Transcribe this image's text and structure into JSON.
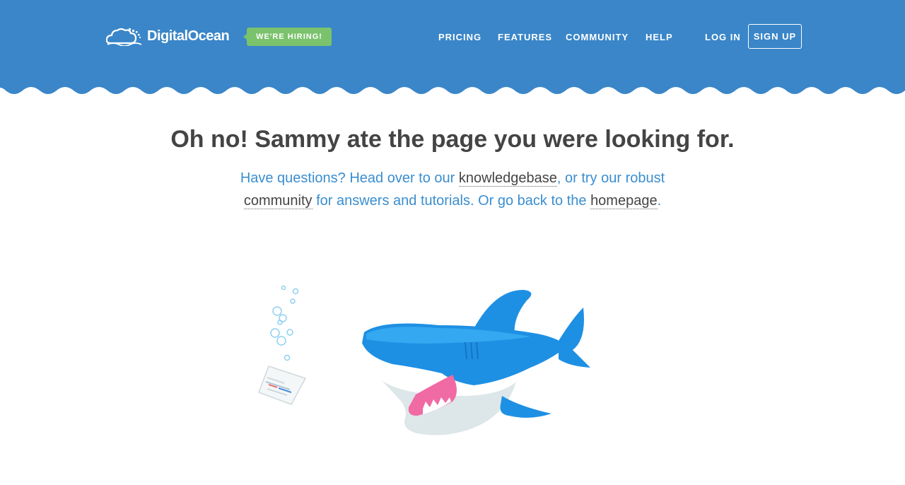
{
  "header": {
    "brand": "DigitalOcean",
    "hiring_badge": "WE'RE HIRING!",
    "nav": [
      "PRICING",
      "FEATURES",
      "COMMUNITY",
      "HELP"
    ],
    "login": "LOG IN",
    "signup": "SIGN UP",
    "colors": {
      "background": "#3a86c8",
      "badge": "#7bc26d"
    }
  },
  "main": {
    "headline": "Oh no! Sammy ate the page you were looking for.",
    "message": {
      "part1": "Have questions? Head over to our ",
      "link_knowledgebase": "knowledgebase",
      "part2": ", or try our robust ",
      "link_community": "community",
      "part3": " for answers and tutorials. Or go back to the ",
      "link_homepage": "homepage",
      "part4": "."
    }
  },
  "illustration": {
    "icons": [
      "shark-illustration",
      "bubbles-illustration",
      "paper-page-illustration"
    ]
  }
}
